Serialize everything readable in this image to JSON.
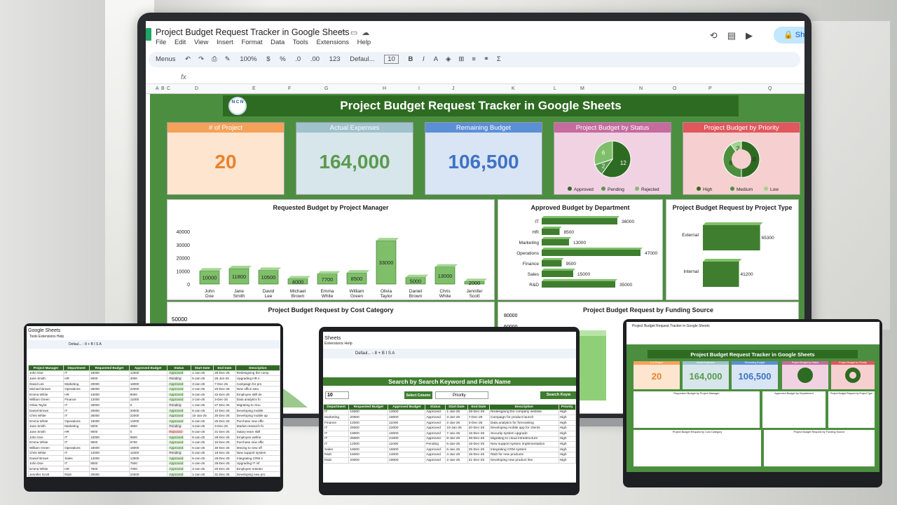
{
  "main": {
    "title": "Project Budget Request Tracker in Google Sheets",
    "menus": [
      "File",
      "Edit",
      "View",
      "Insert",
      "Format",
      "Data",
      "Tools",
      "Extensions",
      "Help"
    ],
    "share": "Sh",
    "toolbar": [
      "Menus",
      "100%",
      "$",
      "%",
      ".0",
      ".00",
      "123",
      "Defaul...",
      "10",
      "B",
      "I"
    ],
    "fx": "fx",
    "columns": [
      "A",
      "B",
      "C",
      "D",
      "E",
      "F",
      "G",
      "H",
      "I",
      "J",
      "K",
      "L",
      "M",
      "N",
      "O",
      "P",
      "Q"
    ],
    "dash_title": "Project Budget Request Tracker in Google Sheets",
    "logo": "N C N"
  },
  "kpis": [
    {
      "label": "# of Project",
      "value": "20",
      "head": "#f4a25a",
      "bg": "#fde5cf",
      "color": "#e8832b"
    },
    {
      "label": "Actual Expenses",
      "value": "164,000",
      "head": "#9fc2cc",
      "bg": "#d7e6ea",
      "color": "#5a9a4f"
    },
    {
      "label": "Remaining Budget",
      "value": "106,500",
      "head": "#5b8fd6",
      "bg": "#d9e5f5",
      "color": "#3f73c4"
    }
  ],
  "status_chart": {
    "label": "Project Budget by Status",
    "head": "#c56b9e",
    "bg": "#f1d2e3",
    "slices": [
      {
        "name": "Approved",
        "value": 12,
        "color": "#2e6b22"
      },
      {
        "name": "Pending",
        "value": 2,
        "color": "#5a9a4f"
      },
      {
        "name": "Rejected",
        "value": 6,
        "color": "#7fbf6a"
      }
    ]
  },
  "priority_chart": {
    "label": "Project Budget by Priority",
    "head": "#e0575c",
    "bg": "#f6d0d0",
    "slices": [
      {
        "name": "High",
        "value": 10,
        "color": "#2e6b22"
      },
      {
        "name": "Medium",
        "value": 8,
        "color": "#4d8f3d"
      },
      {
        "name": "Low",
        "value": 2,
        "color": "#9fd48c"
      }
    ]
  },
  "chart_data": [
    {
      "type": "bar",
      "title": "Requested Budget by Project Manager",
      "categories": [
        "John Doe",
        "Jane Smith",
        "David Lee",
        "Michael Brown",
        "Emma White",
        "William Green",
        "Olivia Taylor",
        "Daniel Brown",
        "Chris White",
        "Jennifer Scott"
      ],
      "values": [
        10000,
        11800,
        10500,
        4000,
        7700,
        8500,
        33000,
        5000,
        13000,
        2000
      ],
      "ylim": [
        0,
        40000
      ],
      "yticks": [
        "40000",
        "30000",
        "20000",
        "10000",
        "0"
      ]
    },
    {
      "type": "bar",
      "orientation": "horizontal",
      "title": "Approved Budget by  Department",
      "categories": [
        "IT",
        "HR",
        "Marketing",
        "Operations",
        "Finance",
        "Sales",
        "R&D"
      ],
      "values": [
        36000,
        8500,
        13000,
        47000,
        9500,
        15000,
        35000
      ]
    },
    {
      "type": "bar",
      "orientation": "horizontal",
      "title": "Project Budget Request by Project Type",
      "categories": [
        "External",
        "Internal"
      ],
      "values": [
        65300,
        41200
      ]
    },
    {
      "type": "area",
      "title": "Project Budget Request by Cost Category",
      "ytick_top": "50000"
    },
    {
      "type": "bar",
      "title": "Project Budget Request by Funding Source",
      "ytick_top": "80000",
      "ytick_2": "60000"
    }
  ],
  "left_device": {
    "title": "Google Sheets",
    "menus": "Tools  Extensions  Help",
    "toolbar": "Defaul...  -  8  +   B  I  S  A",
    "headers": [
      "Project Manager",
      "Department",
      "Requested Budget",
      "Approved Budget",
      "Status",
      "Start Date",
      "End Date",
      "Description"
    ],
    "rows": [
      [
        "John Doe",
        "IT",
        "15000",
        "12000",
        "Approved",
        "1-Jan-25",
        "28-Dec-25",
        "Redesigning the comp"
      ],
      [
        "Jane Smith",
        "HR",
        "6000",
        "4000",
        "Pending",
        "5-Jan-25",
        "25-Jun-25",
        "Upgrading HR s"
      ],
      [
        "David Lee",
        "Marketing",
        "20000",
        "18000",
        "Approved",
        "3-Jan-25",
        "7-Dec-25",
        "Campaign for pro"
      ],
      [
        "Michael Brown",
        "Operations",
        "25000",
        "22000",
        "Approved",
        "4-Jan-25",
        "20-Dec-25",
        "New office setu"
      ],
      [
        "Emma White",
        "HR",
        "10000",
        "8000",
        "Approved",
        "9-Jan-25",
        "22-Dec-25",
        "Employee skill de"
      ],
      [
        "William Green",
        "Finance",
        "12000",
        "11000",
        "Approved",
        "2-Jan-25",
        "3-Dec-25",
        "Data analytics fo"
      ],
      [
        "Olivia Taylor",
        "IT",
        "25000",
        "0",
        "Pending",
        "1-Jan-25",
        "27-Dec-25",
        "Migrating to clou"
      ],
      [
        "Daniel Brown",
        "IT",
        "20000",
        "20000",
        "Approved",
        "8-Jan-25",
        "10-Dec-25",
        "Developing mobile"
      ],
      [
        "Chris White",
        "IT",
        "25000",
        "22000",
        "Approved",
        "10-Jan-25",
        "20-Dec-25",
        "Developing mobile ap"
      ],
      [
        "Emma White",
        "Operations",
        "15000",
        "14000",
        "Approved",
        "6-Jan-25",
        "25-Dec-25",
        "Purchase new offic"
      ],
      [
        "Jane Smith",
        "Marketing",
        "5000",
        "4800",
        "Pending",
        "3-Jan-25",
        "3-Dec-25",
        "Market research fo"
      ],
      [
        "Jane Smith",
        "HR",
        "9000",
        "0",
        "Rejected",
        "5-Jan-25",
        "21-Dec-25",
        "Salary team skill"
      ],
      [
        "John Doe",
        "IT",
        "10000",
        "9500",
        "Approved",
        "8-Jan-25",
        "28-Dec-25",
        "Employee wellne"
      ],
      [
        "Emma White",
        "IT",
        "9000",
        "8700",
        "Approved",
        "4-Jan-25",
        "15-Dec-25",
        "Purchase new offic"
      ],
      [
        "William Green",
        "Operations",
        "18000",
        "18000",
        "Approved",
        "5-Jan-25",
        "30-Dec-25",
        "Moving to new off"
      ],
      [
        "Chris White",
        "IT",
        "12000",
        "11000",
        "Pending",
        "5-Jan-25",
        "18-Dec-25",
        "New support system"
      ],
      [
        "Daniel Brown",
        "Sales",
        "14000",
        "13000",
        "Approved",
        "6-Jan-25",
        "25-Dec-25",
        "Integrating CRM s"
      ],
      [
        "John Doe",
        "IT",
        "8000",
        "7500",
        "Approved",
        "4-Jan-25",
        "28-Dec-25",
        "Upgrading IT inf"
      ],
      [
        "Emma White",
        "HR",
        "7500",
        "7000",
        "Approved",
        "3-Jan-25",
        "20-Dec-25",
        "Employee retentio"
      ],
      [
        "Jennifer Scott",
        "R&D",
        "20000",
        "24000",
        "Approved",
        "1-Jan-25",
        "31-Dec-25",
        "Developing new pro"
      ]
    ]
  },
  "mid_device": {
    "title": "Sheets",
    "menus": "Extensions  Help",
    "toolbar": "Defaul...  -  8  +   B  I  S  A",
    "banner": "Search by Search Keyword and Field Name",
    "search_value": "10",
    "select_label": "Select Column",
    "select_value": "Priority",
    "search_button": "Search Keyw",
    "headers": [
      "Department",
      "Requested Budget",
      "Approved Budget",
      "Status",
      "Start Date",
      "End Date",
      "Description",
      "Priority"
    ],
    "rows": [
      [
        "IT",
        "15000",
        "12000",
        "Approved",
        "1-Jan-25",
        "28-Dec-25",
        "Redesigning the company website",
        "High"
      ],
      [
        "Marketing",
        "20000",
        "18000",
        "Approved",
        "3-Jan-25",
        "7-Dec-25",
        "Campaign for product launch",
        "High"
      ],
      [
        "Finance",
        "12000",
        "11000",
        "Approved",
        "2-Jan-25",
        "3-Dec-25",
        "Data analytics for forecasting",
        "High"
      ],
      [
        "IT",
        "25000",
        "22000",
        "Approved",
        "10-Jan-25",
        "20-Dec-25",
        "Developing mobile app for clients",
        "High"
      ],
      [
        "IT",
        "18000",
        "16000",
        "Approved",
        "7-Jan-25",
        "16-Dec-25",
        "Security system upgrade",
        "High"
      ],
      [
        "IT",
        "25000",
        "21000",
        "Approved",
        "8-Jan-25",
        "28-Dec-25",
        "Migrating to cloud infrastructure",
        "High"
      ],
      [
        "IT",
        "12000",
        "11000",
        "Pending",
        "5-Jan-25",
        "18-Dec-25",
        "New support system implementation",
        "High"
      ],
      [
        "Sales",
        "18000",
        "16000",
        "Approved",
        "6-Jan-25",
        "25-Dec-25",
        "Integrating CRM system",
        "High"
      ],
      [
        "R&D",
        "15000",
        "14000",
        "Approved",
        "4-Jan-25",
        "18-Dec-25",
        "R&D for new products",
        "High"
      ],
      [
        "R&D",
        "20000",
        "18000",
        "Approved",
        "2-Jan-25",
        "21-Dec-25",
        "Developing new product line",
        "High"
      ]
    ]
  },
  "right_device": {
    "title": "Project Budget Request Tracker in Google Sheets",
    "dash_title": "Project Budget Request Tracker in Google Sheets",
    "kpis": [
      "20",
      "164,000",
      "106,500"
    ],
    "kpi_labels": [
      "# of Project",
      "Actual Expenses",
      "Remaining Budget",
      "Project Budget by Status",
      "Project Budget by Priority"
    ],
    "chart_titles": [
      "Requested Budget by Project Manager",
      "Approved Budget by  Department",
      "Project Budget Request by Project Type",
      "Project Budget Request by Cost Category",
      "Project Budget Request by Funding Source"
    ]
  }
}
